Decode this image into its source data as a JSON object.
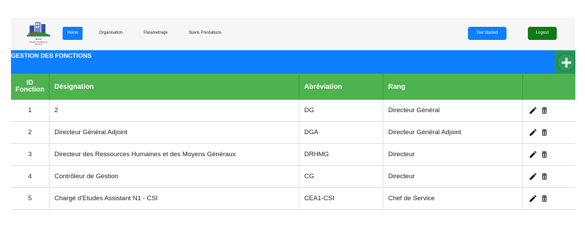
{
  "navbar": {
    "logo": {
      "name": "S.I.C",
      "subtitle": "Société Immobilière du Cameroun"
    },
    "links": [
      {
        "label": "Home",
        "active": true
      },
      {
        "label": "Organisation"
      },
      {
        "label": "Parametrage"
      },
      {
        "label": "Suivis Prestations"
      }
    ],
    "get_started_label": "Get Started",
    "logout_label": "Logout"
  },
  "section": {
    "title": "GESTION DES FONCTIONS",
    "add_icon": "plus-icon"
  },
  "table": {
    "columns": [
      "ID\nFonction",
      "Désignation",
      "Abréviation",
      "Rang",
      ""
    ],
    "column_id_line1": "ID",
    "column_id_line2": "Fonction",
    "rows": [
      {
        "id": "1",
        "designation": "2",
        "abreviation": "DG",
        "rang": "Directeur Général"
      },
      {
        "id": "2",
        "designation": "Directeur Général Adjoint",
        "abreviation": "DGA",
        "rang": "Directeur Général Adjoint"
      },
      {
        "id": "3",
        "designation": "Directeur des Ressources Humaines et des Moyens Généraux",
        "abreviation": "DRHMG",
        "rang": "Directeur"
      },
      {
        "id": "4",
        "designation": "Contrôleur de Gestion",
        "abreviation": "CG",
        "rang": "Directeur"
      },
      {
        "id": "5",
        "designation": "Chargé d'Etudes Assistant N1 - CSI",
        "abreviation": "CEA1-CSI",
        "rang": "Chef de Service"
      }
    ],
    "row_actions": [
      "edit-icon",
      "delete-icon"
    ]
  },
  "colors": {
    "primary": "#0d7fff",
    "table_header": "#4db24f",
    "logout": "#0c7b17",
    "add_button": "#2a9c5a"
  }
}
